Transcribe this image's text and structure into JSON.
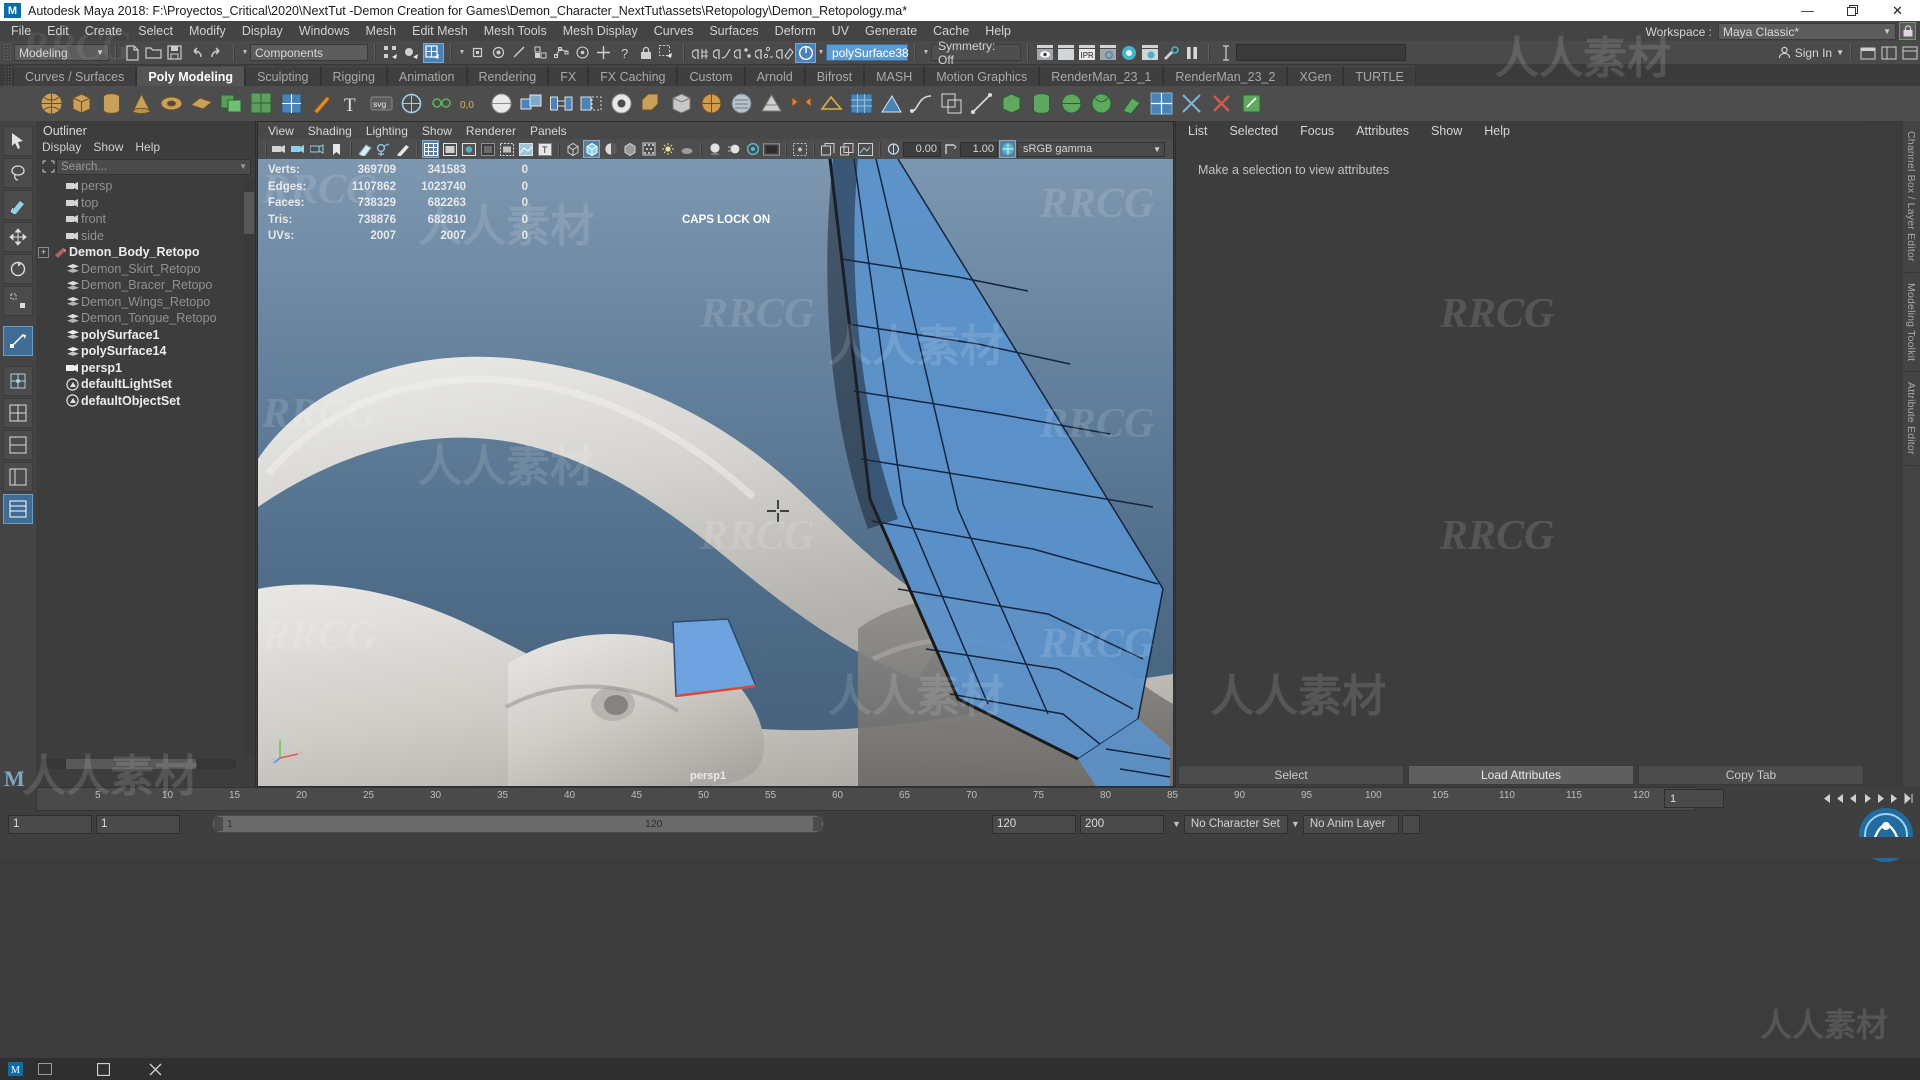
{
  "window": {
    "app_logo": "maya-logo",
    "title": "Autodesk Maya 2018: F:\\Proyectos_Critical\\2020\\NextTut -Demon Creation for Games\\Demon_Character_NextTut\\assets\\Retopology\\Demon_Retopology.ma*",
    "minimize": "—",
    "maximize": "❐",
    "close": "✕"
  },
  "menubar": {
    "items": [
      "File",
      "Edit",
      "Create",
      "Select",
      "Modify",
      "Display",
      "Windows",
      "Mesh",
      "Edit Mesh",
      "Mesh Tools",
      "Mesh Display",
      "Curves",
      "Surfaces",
      "Deform",
      "UV",
      "Generate",
      "Cache",
      "Help"
    ]
  },
  "toolbar": {
    "mode_menu": "Modeling",
    "selection_mask": "Components",
    "object_name": "polySurface38",
    "symmetry": "Symmetry: Off",
    "workspace_label": "Workspace :",
    "workspace_value": "Maya Classic*",
    "sign_in": "Sign In",
    "lock_icon": "lock-icon",
    "search_placeholder": ""
  },
  "shelf": {
    "tabs": [
      {
        "label": "Curves / Surfaces",
        "active": false
      },
      {
        "label": "Poly Modeling",
        "active": true
      },
      {
        "label": "Sculpting",
        "active": false
      },
      {
        "label": "Rigging",
        "active": false
      },
      {
        "label": "Animation",
        "active": false
      },
      {
        "label": "Rendering",
        "active": false
      },
      {
        "label": "FX",
        "active": false
      },
      {
        "label": "FX Caching",
        "active": false
      },
      {
        "label": "Custom",
        "active": false
      },
      {
        "label": "Arnold",
        "active": false
      },
      {
        "label": "Bifrost",
        "active": false
      },
      {
        "label": "MASH",
        "active": false
      },
      {
        "label": "Motion Graphics",
        "active": false
      },
      {
        "label": "RenderMan_23_1",
        "active": false
      },
      {
        "label": "RenderMan_23_2",
        "active": false
      },
      {
        "label": "XGen",
        "active": false
      },
      {
        "label": "TURTLE",
        "active": false
      }
    ]
  },
  "outliner": {
    "title": "Outliner",
    "menu": [
      "Display",
      "Show",
      "Help"
    ],
    "search_placeholder": "Search...",
    "items": [
      {
        "label": "persp",
        "icon": "camera-icon",
        "bold": false,
        "expandable": false
      },
      {
        "label": "top",
        "icon": "camera-icon",
        "bold": false,
        "expandable": false
      },
      {
        "label": "front",
        "icon": "camera-icon",
        "bold": false,
        "expandable": false
      },
      {
        "label": "side",
        "icon": "camera-icon",
        "bold": false,
        "expandable": false
      },
      {
        "label": "Demon_Body_Retopo",
        "icon": "transform-icon",
        "bold": true,
        "expandable": true
      },
      {
        "label": "Demon_Skirt_Retopo",
        "icon": "mesh-icon",
        "bold": false,
        "expandable": false
      },
      {
        "label": "Demon_Bracer_Retopo",
        "icon": "mesh-icon",
        "bold": false,
        "expandable": false
      },
      {
        "label": "Demon_Wings_Retopo",
        "icon": "mesh-icon",
        "bold": false,
        "expandable": false
      },
      {
        "label": "Demon_Tongue_Retopo",
        "icon": "mesh-icon",
        "bold": false,
        "expandable": false
      },
      {
        "label": "polySurface1",
        "icon": "mesh-icon",
        "bold": true,
        "expandable": false
      },
      {
        "label": "polySurface14",
        "icon": "mesh-icon",
        "bold": true,
        "expandable": false
      },
      {
        "label": "persp1",
        "icon": "camera-icon",
        "bold": true,
        "expandable": false
      },
      {
        "label": "defaultLightSet",
        "icon": "set-icon",
        "bold": true,
        "expandable": false
      },
      {
        "label": "defaultObjectSet",
        "icon": "set-icon",
        "bold": true,
        "expandable": false
      }
    ]
  },
  "viewport": {
    "menu": [
      "View",
      "Shading",
      "Lighting",
      "Show",
      "Renderer",
      "Panels"
    ],
    "exposure": "0.00",
    "gamma_value": "1.00",
    "color_management": "sRGB gamma",
    "camera_label": "persp1",
    "caps_lock": "CAPS LOCK ON",
    "heads_up_display": {
      "columns": [
        "label",
        "count_a",
        "count_b",
        "count_c"
      ],
      "rows": [
        {
          "label": "Verts:",
          "a": "369709",
          "b": "341583",
          "c": "0"
        },
        {
          "label": "Edges:",
          "a": "1107862",
          "b": "1023740",
          "c": "0"
        },
        {
          "label": "Faces:",
          "a": "738329",
          "b": "682263",
          "c": "0"
        },
        {
          "label": "Tris:",
          "a": "738876",
          "b": "682810",
          "c": "0"
        },
        {
          "label": "UVs:",
          "a": "2007",
          "b": "2007",
          "c": "0"
        }
      ]
    },
    "axis_labels": [
      "x",
      "y",
      "z"
    ]
  },
  "attribute_editor": {
    "menu": [
      "List",
      "Selected",
      "Focus",
      "Attributes",
      "Show",
      "Help"
    ],
    "message": "Make a selection to view attributes",
    "buttons": [
      {
        "label": "Select",
        "highlight": false
      },
      {
        "label": "Load Attributes",
        "highlight": true
      },
      {
        "label": "Copy Tab",
        "highlight": false
      }
    ]
  },
  "right_vtabs": [
    "Channel Box / Layer Editor",
    "Modeling Toolkit",
    "Attribute Editor"
  ],
  "timeline": {
    "ticks": [
      {
        "label": "5",
        "pos": 5
      },
      {
        "label": "10",
        "pos": 10
      },
      {
        "label": "15",
        "pos": 15
      },
      {
        "label": "20",
        "pos": 20
      },
      {
        "label": "25",
        "pos": 25
      },
      {
        "label": "30",
        "pos": 30
      },
      {
        "label": "35",
        "pos": 35
      },
      {
        "label": "40",
        "pos": 40
      },
      {
        "label": "45",
        "pos": 45
      },
      {
        "label": "50",
        "pos": 50
      },
      {
        "label": "55",
        "pos": 55
      },
      {
        "label": "60",
        "pos": 60
      },
      {
        "label": "65",
        "pos": 65
      },
      {
        "label": "70",
        "pos": 70
      },
      {
        "label": "75",
        "pos": 75
      },
      {
        "label": "80",
        "pos": 80
      },
      {
        "label": "85",
        "pos": 85
      },
      {
        "label": "90",
        "pos": 90
      },
      {
        "label": "95",
        "pos": 95
      },
      {
        "label": "100",
        "pos": 100
      },
      {
        "label": "105",
        "pos": 105
      },
      {
        "label": "110",
        "pos": 110
      },
      {
        "label": "115",
        "pos": 115
      },
      {
        "label": "120",
        "pos": 120
      }
    ],
    "current_frame": "1",
    "playback_icons": [
      "key-prev-icon",
      "step-back-icon",
      "play-back-icon",
      "play-forward-icon",
      "step-forward-icon",
      "key-next-icon",
      "end-icon"
    ]
  },
  "range_slider": {
    "anim_start": "1",
    "anim_end": "1",
    "range_start": "1",
    "range_end": "120",
    "playback_end": "120",
    "anim_total": "200",
    "character_set": "No Character Set",
    "anim_layer": "No Anim Layer",
    "badge": "rrcg-badge"
  },
  "watermarks": {
    "latin": "RRCG",
    "cjk": "人人素材"
  },
  "colors": {
    "accent_blue": "#4a82b8",
    "selection_blue": "#5b9bd1",
    "panel_bg": "#3d3d3d",
    "toolbar_bg": "#4a4a4a",
    "mesh_blue": "#5b92cc",
    "hud_text": "#e8e8e8"
  }
}
